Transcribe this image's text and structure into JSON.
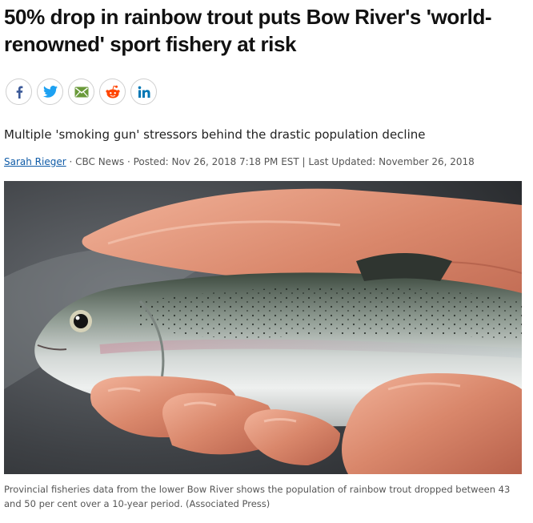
{
  "article": {
    "headline": "50% drop in rainbow trout puts Bow River's 'world-renowned' sport fishery at risk",
    "subheadline": "Multiple 'smoking gun' stressors behind the drastic population decline",
    "author": "Sarah Rieger",
    "byline_rest": " · CBC News · Posted: Nov 26, 2018 7:18 PM EST | Last Updated: November 26, 2018",
    "photo_caption": "Provincial fisheries data from the lower Bow River shows the population of rainbow trout dropped between 43 and 50 per cent over a 10-year period. (Associated Press)"
  },
  "share": [
    {
      "icon": "facebook-icon",
      "color": "#3b5998"
    },
    {
      "icon": "twitter-icon",
      "color": "#1da1f2"
    },
    {
      "icon": "email-icon",
      "color": "#6a9a3a"
    },
    {
      "icon": "reddit-icon",
      "color": "#ff4500"
    },
    {
      "icon": "linkedin-icon",
      "color": "#0077b5"
    }
  ],
  "colors": {
    "link": "#0f5ba7",
    "headline": "#111111",
    "meta": "#555555"
  }
}
